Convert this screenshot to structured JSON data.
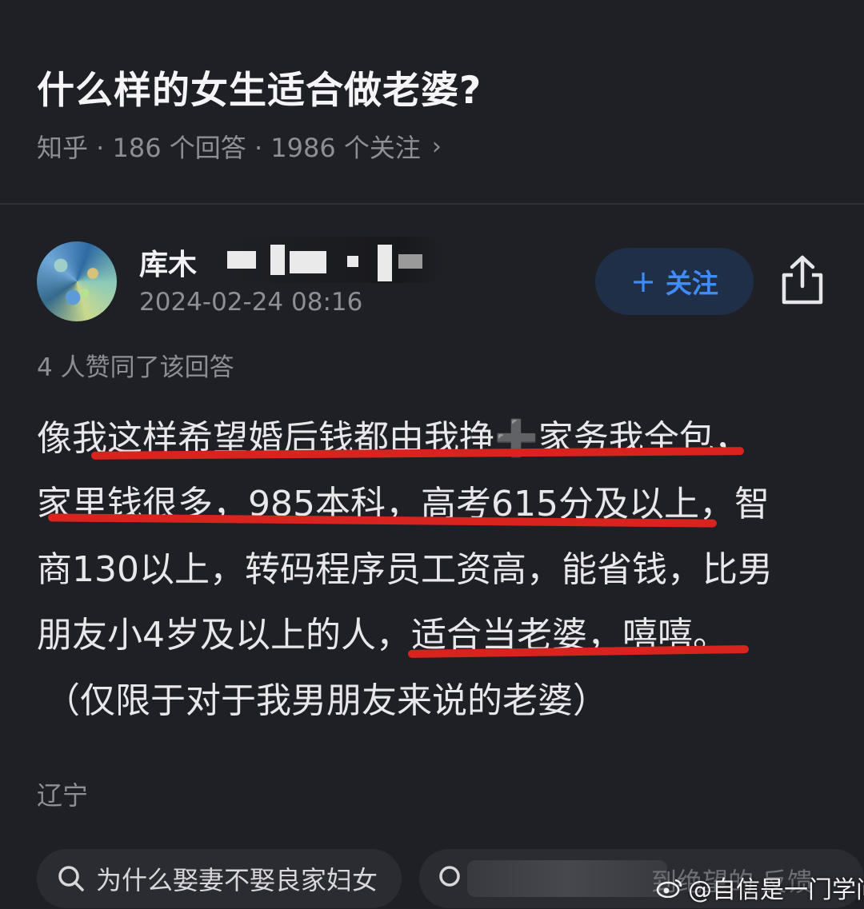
{
  "question": {
    "title": "什么样的女生适合做老婆?",
    "meta": "知乎 · 186 个回答 · 1986 个关注",
    "chevron": "›"
  },
  "author": {
    "name_visible": "库木",
    "timestamp": "2024-02-24 08:16",
    "follow_label": "关注",
    "follow_plus": "+",
    "avatar_icon": "avatar-image",
    "share_icon": "share-icon"
  },
  "upvote_text": "4 人赞同了该回答",
  "answer": {
    "lines": [
      "像我这样希望婚后钱都由我挣",
      "➕",
      "家务我全包，",
      "家里钱很多，985本科，高考615分及以上，智",
      "商130以上，转码程序员工资高，能省钱，比男",
      "朋友小4岁及以上的人，适合当老婆，嘻嘻。",
      "（仅限于对于我男朋友来说的老婆）"
    ]
  },
  "location": "辽宁",
  "related_searches": [
    "为什么娶妻不娶良家妇女",
    "到绝望的 反馈"
  ],
  "watermark": "@自信是一门学问",
  "colors": {
    "background": "#1f2025",
    "accent": "#3f8cff",
    "underline": "#d9231e",
    "muted": "#8d8f96"
  }
}
